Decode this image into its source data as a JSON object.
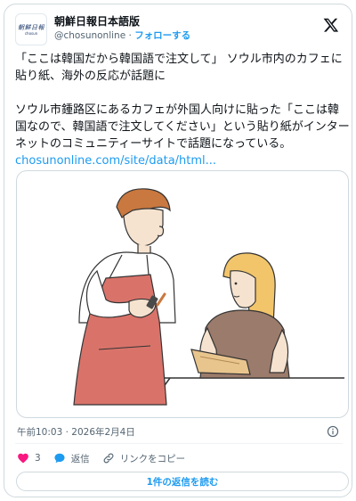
{
  "account": {
    "avatar_line1": "朝鮮日報",
    "avatar_line2": "chosun",
    "display_name": "朝鮮日報日本語版",
    "handle": "@chosunonline",
    "separator": " · ",
    "follow_label": "フォローする"
  },
  "tweet": {
    "headline": "「ここは韓国だから韓国語で注文して」 ソウル市内のカフェに貼り紙、海外の反応が話題に",
    "body": "ソウル市鍾路区にあるカフェが外国人向けに貼った「ここは韓国なので、韓国語で注文してください」という貼り紙がインターネットのコミュニティーサイトで話題になっている。",
    "link_text": "chosunonline.com/site/data/html..."
  },
  "timestamp": "午前10:03 · 2026年2月4日",
  "actions": {
    "like_count": "3",
    "reply_label": "返信",
    "copy_link_label": "リンクをコピー"
  },
  "read_replies_label": "1件の返信を読む",
  "colors": {
    "accent": "#1d9bf0",
    "like": "#f91880",
    "apron": "#d9736a",
    "hair_server": "#c9783f",
    "hair_customer": "#f2c56b",
    "shirt_customer": "#9b7b6b"
  },
  "icons": [
    "x-logo-icon",
    "info-icon",
    "heart-icon",
    "reply-bubble-icon",
    "link-icon"
  ]
}
